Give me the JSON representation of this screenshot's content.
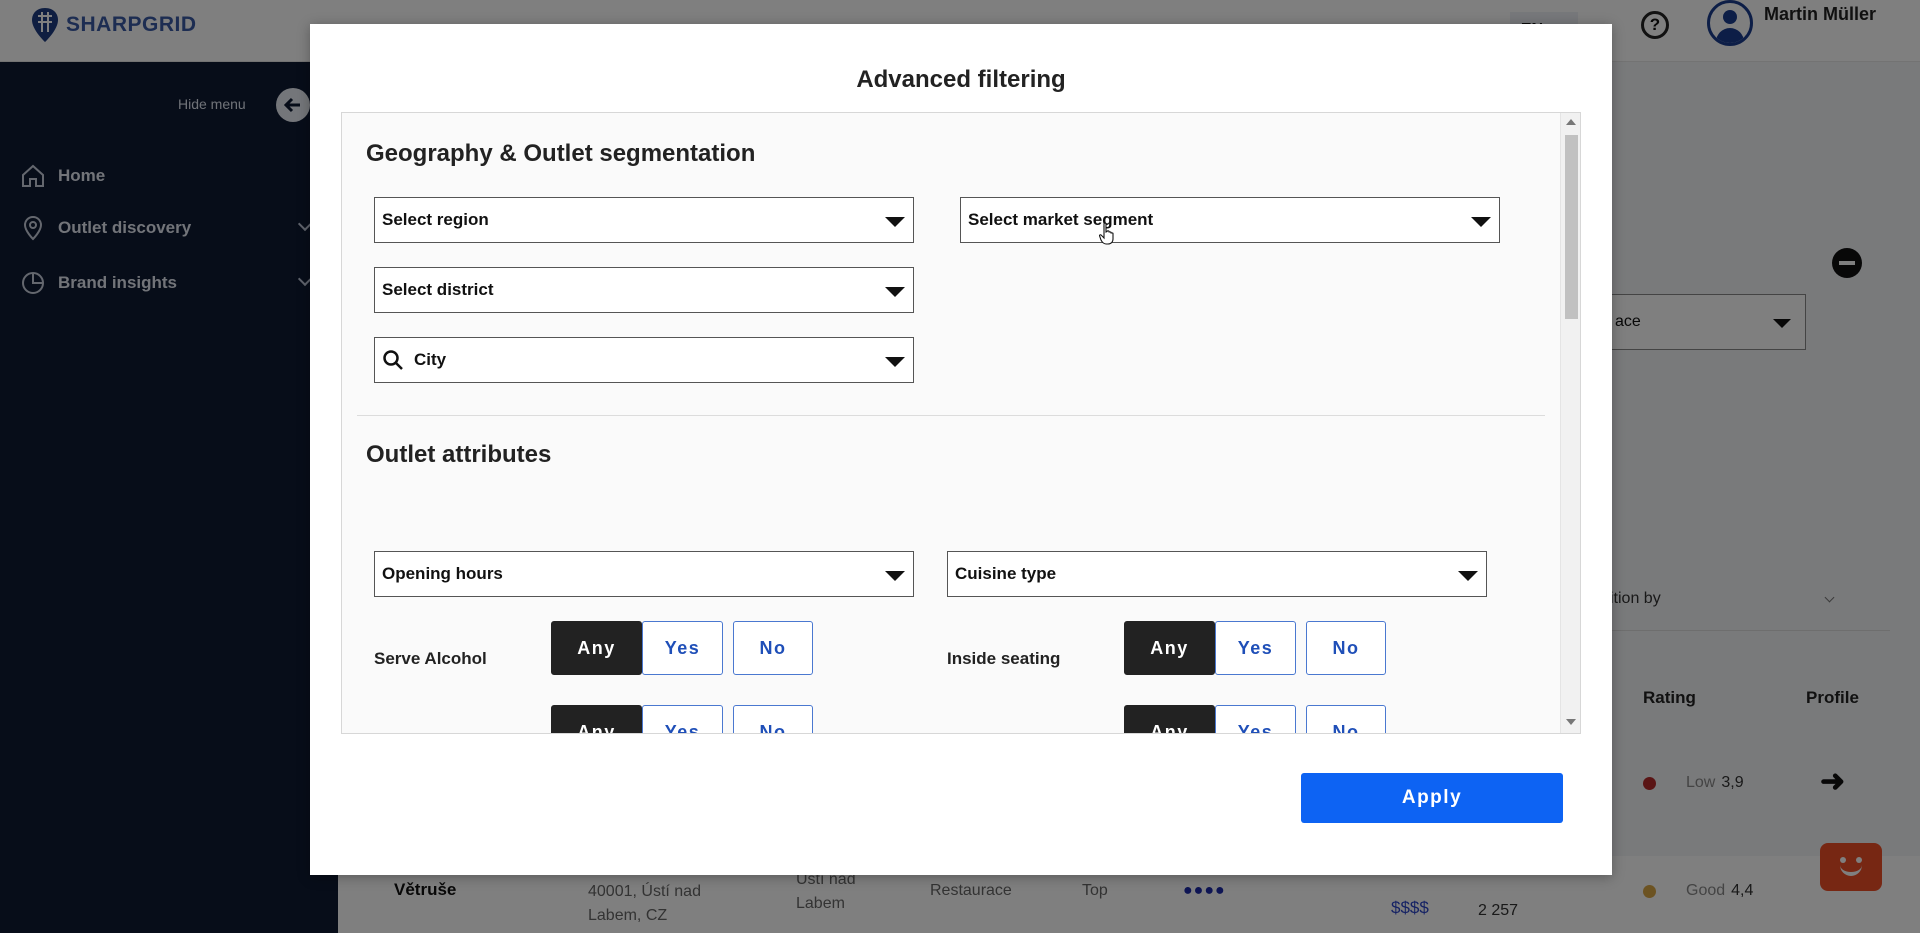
{
  "app": {
    "logo_text": "SHARPGRID",
    "language": "EN",
    "user_name": "Martin Müller"
  },
  "sidebar": {
    "hide_menu_label": "Hide menu",
    "items": [
      {
        "label": "Home",
        "icon": "home-icon"
      },
      {
        "label": "Outlet discovery",
        "icon": "map-pin-icon"
      },
      {
        "label": "Brand insights",
        "icon": "pie-chart-icon"
      }
    ]
  },
  "background": {
    "segment_select_partial": "ace",
    "sort_label_partial": "ition by",
    "columns": {
      "rating": "Rating",
      "profile": "Profile"
    },
    "rows": [
      {
        "rating_label": "Low",
        "rating_value": "3,9",
        "rating_color": "#b52a2a"
      },
      {
        "name": "Větruše",
        "address": "40001, Ústí nad Labem, CZ",
        "city": "Ústí nad Labem",
        "type": "Restaurace",
        "tier": "Top",
        "dots": "●●●●",
        "price": "$$$$",
        "count": "2 257",
        "rating_label": "Good",
        "rating_value": "4,4",
        "rating_color": "#d9a645"
      }
    ]
  },
  "modal": {
    "title": "Advanced filtering",
    "geography": {
      "title": "Geography & Outlet segmentation",
      "region_placeholder": "Select region",
      "district_placeholder": "Select district",
      "city_placeholder": "City",
      "market_segment_placeholder": "Select market segment"
    },
    "attributes": {
      "title": "Outlet attributes",
      "opening_hours_placeholder": "Opening hours",
      "cuisine_type_placeholder": "Cuisine type",
      "serve_alcohol_label": "Serve Alcohol",
      "inside_seating_label": "Inside seating",
      "options": {
        "any": "Any",
        "yes": "Yes",
        "no": "No"
      }
    },
    "apply_label": "Apply"
  },
  "colors": {
    "primary": "#0d63f3",
    "sidebar_bg": "#0e1a33",
    "toggle_active": "#222222",
    "toggle_outline": "#4a78d0"
  }
}
